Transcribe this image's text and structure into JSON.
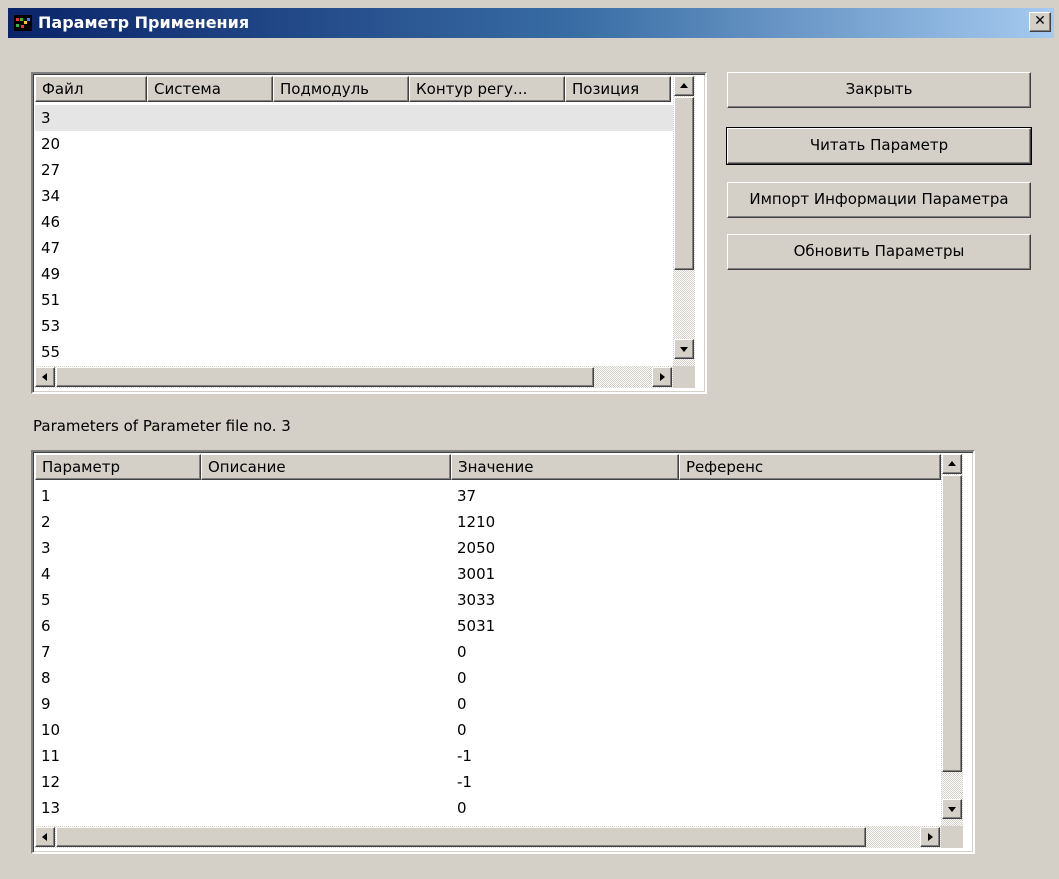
{
  "window": {
    "title": "Параметр Применения",
    "close_glyph": "✕"
  },
  "buttons": {
    "close": "Закрыть",
    "read": "Читать Параметр",
    "import": "Импорт Информации Параметра",
    "update": "Обновить Параметры"
  },
  "file_list": {
    "columns": [
      "Файл",
      "Система",
      "Подмодуль",
      "Контур регу...",
      "Позиция"
    ],
    "rows": [
      "3",
      "20",
      "27",
      "34",
      "46",
      "47",
      "49",
      "51",
      "53",
      "55"
    ],
    "selected_index": 0
  },
  "caption": "Parameters of Parameter file no. 3",
  "param_list": {
    "columns": [
      "Параметр",
      "Описание",
      "Значение",
      "Референс"
    ],
    "rows": [
      [
        "1",
        "",
        "37",
        ""
      ],
      [
        "2",
        "",
        "1210",
        ""
      ],
      [
        "3",
        "",
        "2050",
        ""
      ],
      [
        "4",
        "",
        "3001",
        ""
      ],
      [
        "5",
        "",
        "3033",
        ""
      ],
      [
        "6",
        "",
        "5031",
        ""
      ],
      [
        "7",
        "",
        "0",
        ""
      ],
      [
        "8",
        "",
        "0",
        ""
      ],
      [
        "9",
        "",
        "0",
        ""
      ],
      [
        "10",
        "",
        "0",
        ""
      ],
      [
        "11",
        "",
        "-1",
        ""
      ],
      [
        "12",
        "",
        "-1",
        ""
      ],
      [
        "13",
        "",
        "0",
        ""
      ]
    ]
  },
  "colors": {
    "titlebar_start": "#0a246a",
    "titlebar_end": "#a6caf0",
    "face": "#d4d0c8",
    "selected_row": "#e5e5e5"
  },
  "icons": {
    "title": "application-icon",
    "close": "close-icon"
  }
}
